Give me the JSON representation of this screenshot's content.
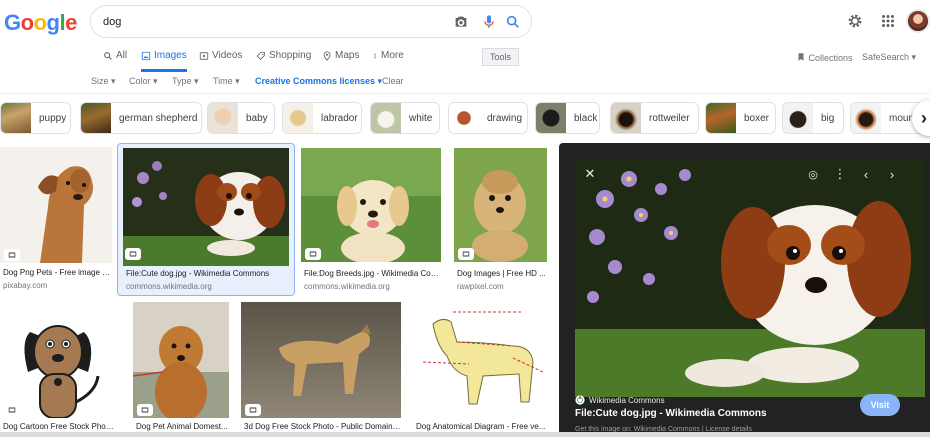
{
  "header": {
    "logo_letters": [
      "G",
      "o",
      "o",
      "g",
      "l",
      "e"
    ],
    "search_value": "dog",
    "icons": {
      "camera": "camera-icon",
      "mic": "microphone-icon",
      "search": "search-icon",
      "settings": "gear-icon",
      "apps": "apps-grid-icon"
    }
  },
  "tabs": [
    {
      "label": "All",
      "icon": "search-icon"
    },
    {
      "label": "Images",
      "icon": "image-icon"
    },
    {
      "label": "Videos",
      "icon": "video-icon"
    },
    {
      "label": "Shopping",
      "icon": "tag-icon"
    },
    {
      "label": "Maps",
      "icon": "pin-icon"
    },
    {
      "label": "More",
      "icon": "dots-icon"
    }
  ],
  "tools_label": "Tools",
  "right_links": {
    "collections": "Collections",
    "safesearch": "SafeSearch ▾"
  },
  "filters": {
    "size": "Size ▾",
    "color": "Color ▾",
    "type": "Type ▾",
    "time": "Time ▾",
    "license": "Creative Commons licenses ▾",
    "clear": "Clear"
  },
  "chips": [
    {
      "label": "puppy"
    },
    {
      "label": "german shepherd"
    },
    {
      "label": "baby"
    },
    {
      "label": "labrador"
    },
    {
      "label": "white"
    },
    {
      "label": "drawing"
    },
    {
      "label": "black"
    },
    {
      "label": "rottweiler"
    },
    {
      "label": "boxer"
    },
    {
      "label": "big"
    },
    {
      "label": "mount"
    }
  ],
  "results": [
    {
      "caption": "Dog Png Pets - Free image o...",
      "source": "pixabay.com"
    },
    {
      "caption": "File:Cute dog.jpg - Wikimedia Commons",
      "source": "commons.wikimedia.org"
    },
    {
      "caption": "File:Dog Breeds.jpg - Wikimedia Com...",
      "source": "commons.wikimedia.org"
    },
    {
      "caption": "Dog Images | Free HD ...",
      "source": "rawpixel.com"
    },
    {
      "caption": "Dog Cartoon Free Stock Photo ...",
      "source": ""
    },
    {
      "caption": "Dog Pet Animal Domest...",
      "source": ""
    },
    {
      "caption": "3d Dog Free Stock Photo - Public Domain ...",
      "source": ""
    },
    {
      "caption": "Dog Anatomical Diagram - Free ve...",
      "source": ""
    }
  ],
  "preview": {
    "source": "Wikimedia Commons",
    "title": "File:Cute dog.jpg - Wikimedia Commons",
    "description": "Get this image on: Wikimedia Commons | License details",
    "visit_label": "Visit"
  },
  "colors": {
    "accent": "#1a73e8",
    "panel_bg": "#222222",
    "visit_bg": "#8ab4f8"
  }
}
